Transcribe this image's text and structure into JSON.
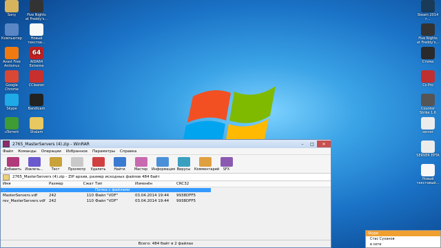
{
  "desktop": {
    "icons_left": [
      {
        "label": "Sony",
        "icon": "user-folder-icon",
        "color": "#d7b35e"
      },
      {
        "label": "Компьютер",
        "icon": "computer-icon",
        "color": "#5a86c5"
      },
      {
        "label": "Avast Free Antivirus",
        "icon": "avast-icon",
        "color": "#f07a10"
      },
      {
        "label": "Google Chrome",
        "icon": "chrome-icon",
        "color": "#d94735"
      },
      {
        "label": "Skype",
        "icon": "skype-icon",
        "color": "#1fa9e6"
      },
      {
        "label": "uTorrent",
        "icon": "utorrent-icon",
        "color": "#3f9b33"
      }
    ],
    "icons_second": [
      {
        "label": "Five Nights at Freddy's...",
        "icon": "fnaf-icon",
        "color": "#333333"
      },
      {
        "label": "Новый текстов...",
        "icon": "text-file-icon",
        "color": "#f8f8f8"
      },
      {
        "label": "AIDA64 Extreme",
        "icon": "aida64-icon",
        "color": "#c02020",
        "badge": "64"
      },
      {
        "label": "CCleaner",
        "icon": "ccleaner-icon",
        "color": "#c8302e"
      },
      {
        "label": "Bandicam",
        "icon": "bandicam-icon",
        "color": "#222222"
      },
      {
        "label": "Shalam",
        "icon": "folder-icon",
        "color": "#e8c860"
      }
    ],
    "icons_right": [
      {
        "label": "Steam 2014 г...",
        "icon": "steam-icon",
        "color": "#1a3a5a"
      },
      {
        "label": "Five Nights at Freddy's...",
        "icon": "fnaf-icon",
        "color": "#333333"
      },
      {
        "label": "Стима",
        "icon": "steam-icon",
        "color": "#2a2a2a"
      },
      {
        "label": "Cs Pro",
        "icon": "cs-icon",
        "color": "#c03030"
      },
      {
        "label": "Counter Strike 1.6",
        "icon": "counter-strike-icon",
        "color": "#555555"
      },
      {
        "label": "server",
        "icon": "server-file-icon",
        "color": "#ececec"
      },
      {
        "label": "SERVER EPTA",
        "icon": "server-file-icon",
        "color": "#ececec"
      },
      {
        "label": "Новый текстовый...",
        "icon": "text-file-icon",
        "color": "#f8f8f8"
      }
    ]
  },
  "winrar": {
    "title": "2765_MasterServers (4).zip - WinRAR",
    "menu": [
      "Файл",
      "Команды",
      "Операции",
      "Избранное",
      "Параметры",
      "Справка"
    ],
    "toolbar": [
      {
        "label": "Добавить",
        "icon": "add-archive-icon",
        "color": "#b03a7a"
      },
      {
        "label": "Извлечь...",
        "icon": "extract-icon",
        "color": "#6a5acd"
      },
      {
        "label": "Тест",
        "icon": "test-icon",
        "color": "#c9a23a"
      },
      {
        "label": "Просмотр",
        "icon": "view-icon",
        "color": "#c9c9c9"
      },
      {
        "label": "Удалить",
        "icon": "delete-icon",
        "color": "#d04040"
      },
      {
        "label": "Найти",
        "icon": "find-icon",
        "color": "#3a7ad0"
      },
      {
        "label": "Мастер",
        "icon": "wizard-icon",
        "color": "#c86ab0"
      },
      {
        "label": "Информация",
        "icon": "info-icon",
        "color": "#4a90d9"
      },
      {
        "label": "Вирусы",
        "icon": "virus-scan-icon",
        "color": "#3aa0c0"
      },
      {
        "label": "Комментарий",
        "icon": "comment-icon",
        "color": "#e0a040"
      },
      {
        "label": "SFX",
        "icon": "sfx-icon",
        "color": "#8a5ab0"
      }
    ],
    "address": "2765_MasterServers (4).zip - ZIP архив, размер исходных файлов 484 байт",
    "columns": [
      "Имя",
      "Размер",
      "Сжат",
      "Тип",
      "Изменён",
      "CRC32"
    ],
    "rows": [
      {
        "name": "..",
        "size": "",
        "packed": "",
        "type": "Папка с файлами",
        "modified": "",
        "crc": "",
        "selected": true
      },
      {
        "name": "MasterServers.vdf",
        "size": "242",
        "packed": "110",
        "type": "Файл \"VDF\"",
        "modified": "03.04.2014 19:44",
        "crc": "9938DFF5",
        "selected": false
      },
      {
        "name": "rev_MasterServers.vdf",
        "size": "242",
        "packed": "110",
        "type": "Файл \"VDF\"",
        "modified": "03.04.2014 19:44",
        "crc": "9938DFF5",
        "selected": false
      }
    ],
    "status": "Всего: 484 байт в 2 файлах"
  },
  "notification": {
    "header": "Skype",
    "lines": [
      "Стас Суханов",
      "в сети"
    ]
  }
}
